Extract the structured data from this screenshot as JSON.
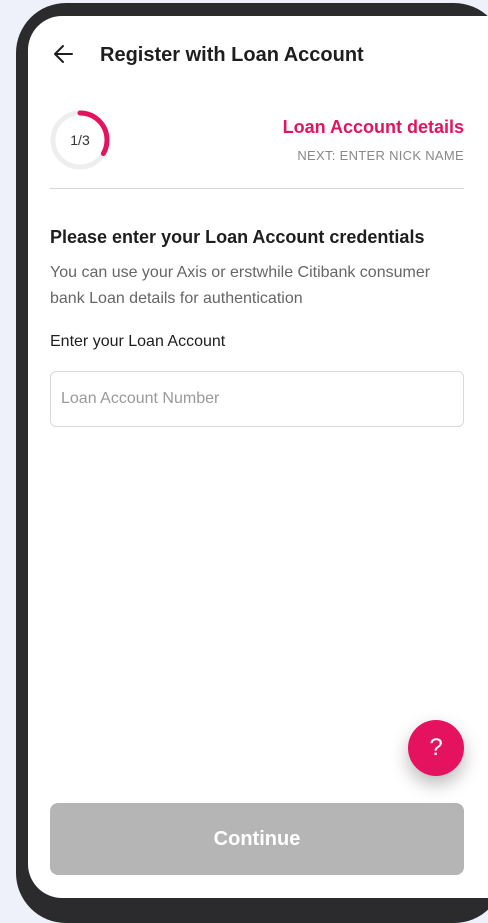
{
  "header": {
    "title": "Register with Loan Account",
    "back_icon": "back-arrow-icon"
  },
  "stepper": {
    "current": 1,
    "total": 3,
    "label": "1/3",
    "progress_fraction": 0.333,
    "title": "Loan Account details",
    "next": "NEXT: ENTER NICK NAME"
  },
  "content": {
    "heading": "Please enter your Loan Account credentials",
    "description": "You can use your Axis or erstwhile Citibank consumer bank Loan details for authentication",
    "field_label": "Enter your Loan Account",
    "input_placeholder": "Loan Account Number",
    "input_value": ""
  },
  "help": {
    "label": "?",
    "icon": "help-icon"
  },
  "actions": {
    "continue_label": "Continue"
  },
  "colors": {
    "accent": "#e5135f",
    "disabled_button": "#b5b5b5",
    "background": "#eef1fa",
    "frame": "#2b2b2d"
  }
}
